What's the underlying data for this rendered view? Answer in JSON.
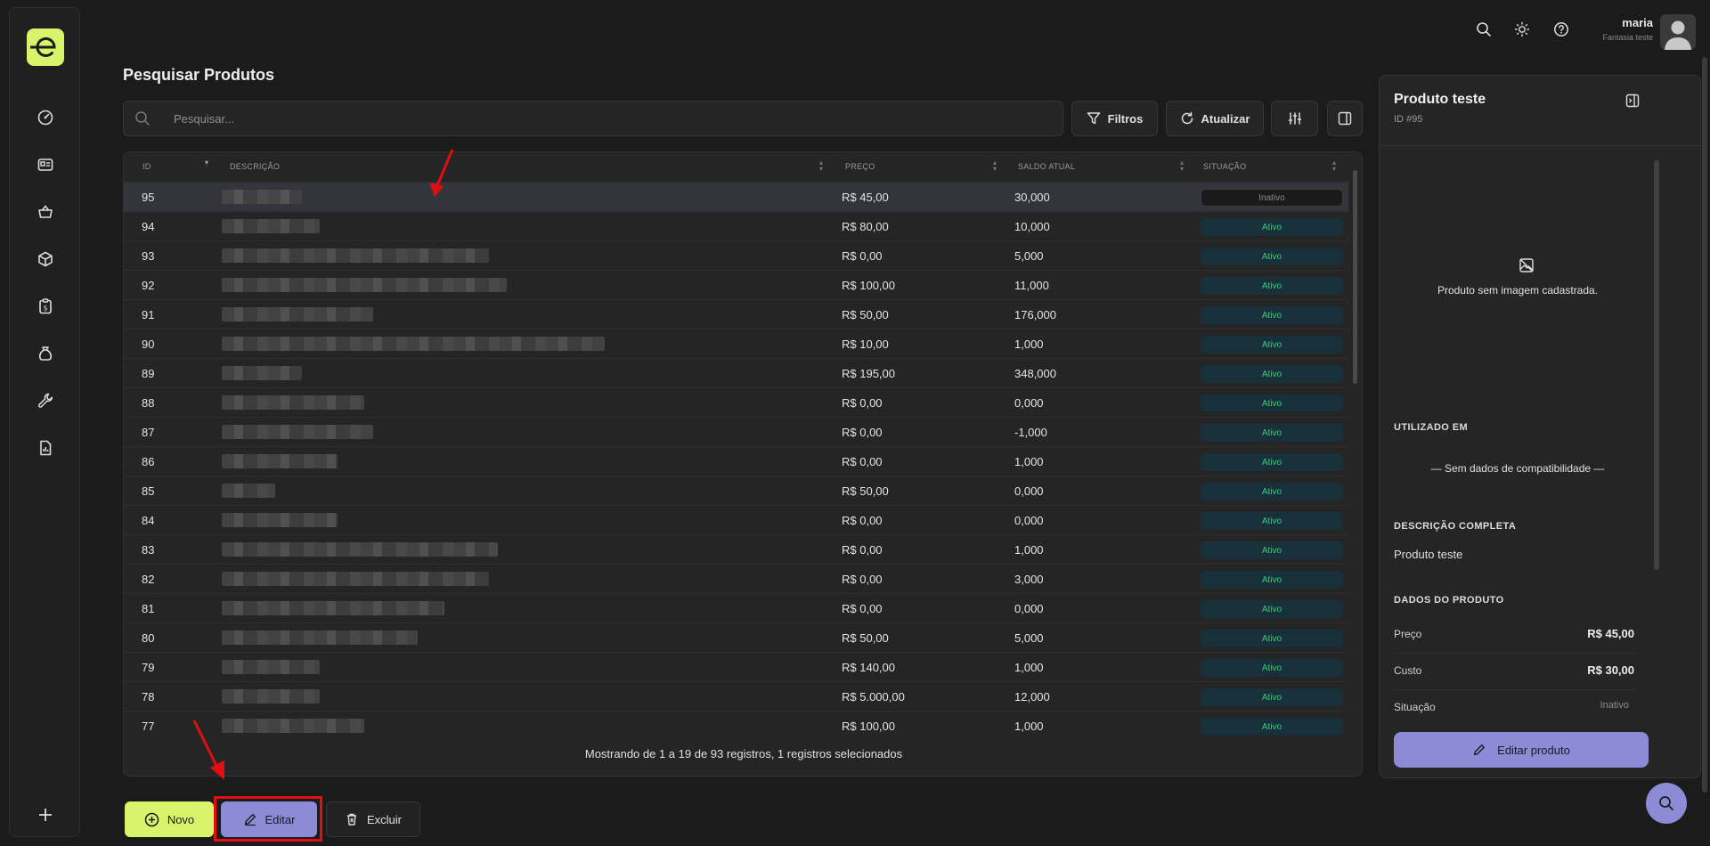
{
  "header": {
    "user_name": "maria",
    "company": "Fantasia teste"
  },
  "page": {
    "title": "Pesquisar Produtos"
  },
  "search": {
    "placeholder": "Pesquisar..."
  },
  "toolbar": {
    "filters_label": "Filtros",
    "refresh_label": "Atualizar"
  },
  "table": {
    "columns": [
      "ID",
      "DESCRIÇÃO",
      "PREÇO",
      "SALDO ATUAL",
      "SITUAÇÃO"
    ],
    "rows": [
      {
        "id": "95",
        "price": "R$ 45,00",
        "stock": "30,000",
        "status": "Inativo",
        "selected": true
      },
      {
        "id": "94",
        "price": "R$ 80,00",
        "stock": "10,000",
        "status": "Ativo"
      },
      {
        "id": "93",
        "price": "R$ 0,00",
        "stock": "5,000",
        "status": "Ativo"
      },
      {
        "id": "92",
        "price": "R$ 100,00",
        "stock": "11,000",
        "status": "Ativo"
      },
      {
        "id": "91",
        "price": "R$ 50,00",
        "stock": "176,000",
        "status": "Ativo"
      },
      {
        "id": "90",
        "price": "R$ 10,00",
        "stock": "1,000",
        "status": "Ativo"
      },
      {
        "id": "89",
        "price": "R$ 195,00",
        "stock": "348,000",
        "status": "Ativo"
      },
      {
        "id": "88",
        "price": "R$ 0,00",
        "stock": "0,000",
        "status": "Ativo"
      },
      {
        "id": "87",
        "price": "R$ 0,00",
        "stock": "-1,000",
        "status": "Ativo"
      },
      {
        "id": "86",
        "price": "R$ 0,00",
        "stock": "1,000",
        "status": "Ativo"
      },
      {
        "id": "85",
        "price": "R$ 50,00",
        "stock": "0,000",
        "status": "Ativo"
      },
      {
        "id": "84",
        "price": "R$ 0,00",
        "stock": "0,000",
        "status": "Ativo"
      },
      {
        "id": "83",
        "price": "R$ 0,00",
        "stock": "1,000",
        "status": "Ativo"
      },
      {
        "id": "82",
        "price": "R$ 0,00",
        "stock": "3,000",
        "status": "Ativo"
      },
      {
        "id": "81",
        "price": "R$ 0,00",
        "stock": "0,000",
        "status": "Ativo"
      },
      {
        "id": "80",
        "price": "R$ 50,00",
        "stock": "5,000",
        "status": "Ativo"
      },
      {
        "id": "79",
        "price": "R$ 140,00",
        "stock": "1,000",
        "status": "Ativo"
      },
      {
        "id": "78",
        "price": "R$ 5.000,00",
        "stock": "12,000",
        "status": "Ativo"
      },
      {
        "id": "77",
        "price": "R$ 100,00",
        "stock": "1,000",
        "status": "Ativo"
      }
    ],
    "footer": "Mostrando de 1 a 19 de 93 registros, 1 registros selecionados"
  },
  "actions": {
    "new_label": "Novo",
    "edit_label": "Editar",
    "delete_label": "Excluir"
  },
  "panel": {
    "title": "Produto teste",
    "id_label": "ID #95",
    "no_image": "Produto sem imagem cadastrada.",
    "used_in_heading": "UTILIZADO EM",
    "no_compat": "— Sem dados de compatibilidade —",
    "full_desc_heading": "DESCRIÇÃO COMPLETA",
    "full_desc": "Produto teste",
    "product_data_heading": "DADOS DO PRODUTO",
    "fields": [
      {
        "label": "Preço",
        "value": "R$ 45,00"
      },
      {
        "label": "Custo",
        "value": "R$ 30,00"
      },
      {
        "label": "Situação",
        "value": "Inativo"
      }
    ],
    "edit_button": "Editar produto"
  },
  "colors": {
    "accent_lime": "#d9f46b",
    "accent_purple": "#8d8ad6",
    "status_active": "#34d17a",
    "annotation_red": "#e10f0f"
  },
  "icons": {
    "sidebar": [
      "dashboard-icon",
      "contacts-card-icon",
      "basket-icon",
      "box-icon",
      "clipboard-money-icon",
      "money-bag-icon",
      "wrench-icon",
      "report-icon",
      "plus-icon"
    ],
    "header": [
      "search-icon",
      "sun-icon",
      "help-icon"
    ]
  }
}
